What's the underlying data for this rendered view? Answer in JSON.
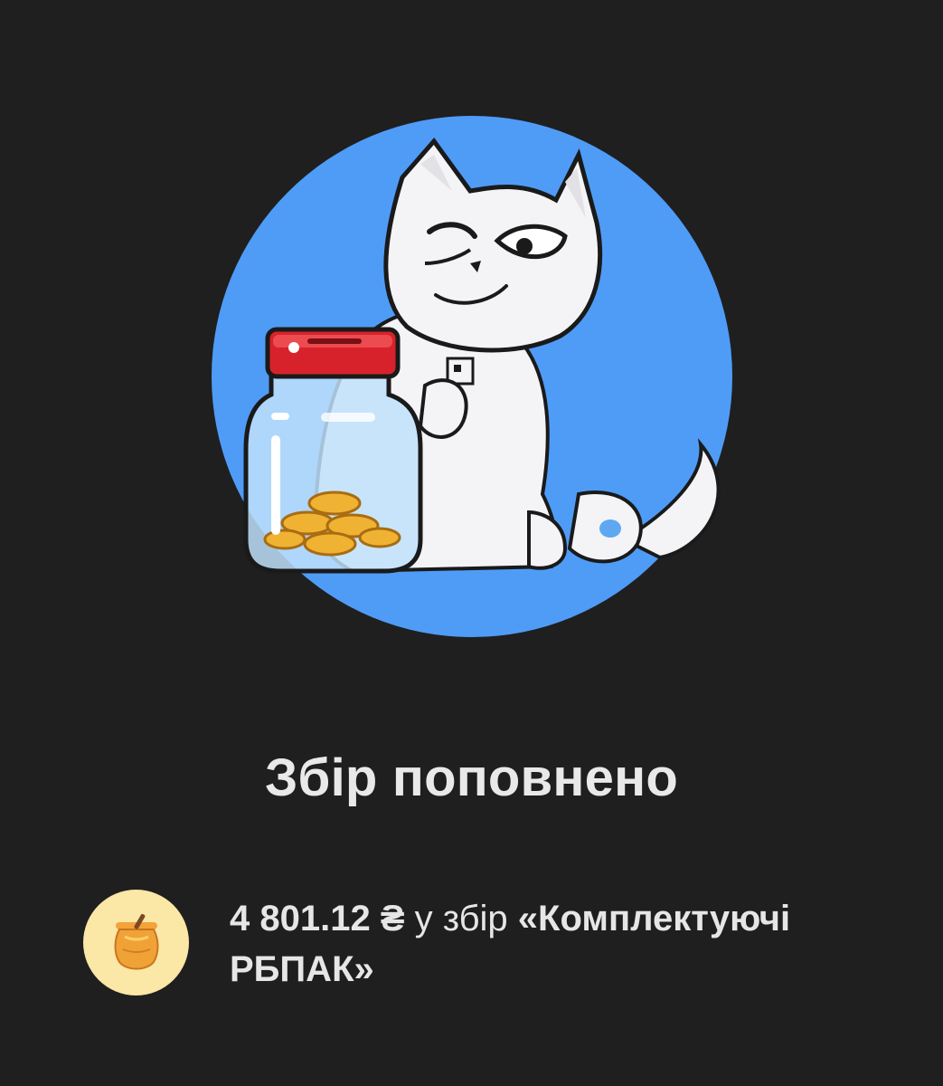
{
  "result": {
    "title": "Збір поповнено",
    "amount": "4 801.12 ₴",
    "middle": " у збір ",
    "jar_name": "«Комплектуючі РБПАК»"
  },
  "icons": {
    "hero": "cat-with-money-jar-illustration",
    "badge": "honey-pot-icon"
  },
  "colors": {
    "background": "#1f1f1f",
    "hero_circle": "#4f9cf7",
    "badge_bg": "#fbe7a6",
    "lid_red": "#d8222b"
  }
}
